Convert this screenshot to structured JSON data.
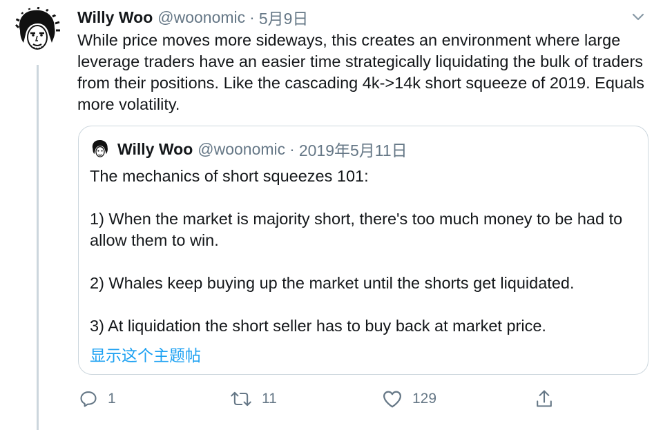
{
  "tweet": {
    "author_name": "Willy Woo",
    "handle": "@woonomic",
    "separator": "·",
    "date": "5月9日",
    "text": "While price moves more sideways, this creates an environment where large leverage traders have an easier time strategically liquidating the bulk of traders from their positions. Like the cascading 4k->14k short squeeze of 2019. Equals more volatility."
  },
  "quoted": {
    "author_name": "Willy Woo",
    "handle": "@woonomic",
    "separator": "·",
    "date": "2019年5月11日",
    "paragraphs": [
      "The mechanics of short squeezes 101:",
      "1) When the market is majority short, there's too much money to be had to allow them to win.",
      "2) Whales keep buying up the market until the shorts get liquidated.",
      "3) At liquidation the short seller has to buy back at market price."
    ],
    "show_thread": "显示这个主题帖"
  },
  "actions": {
    "reply_count": "1",
    "retweet_count": "11",
    "like_count": "129"
  },
  "colors": {
    "text": "#14171a",
    "secondary": "#657786",
    "link": "#1da1f2",
    "border": "#ccd6dd"
  },
  "icons": [
    "reply-icon",
    "retweet-icon",
    "like-icon",
    "share-icon",
    "chevron-down-icon",
    "avatar-icon"
  ]
}
